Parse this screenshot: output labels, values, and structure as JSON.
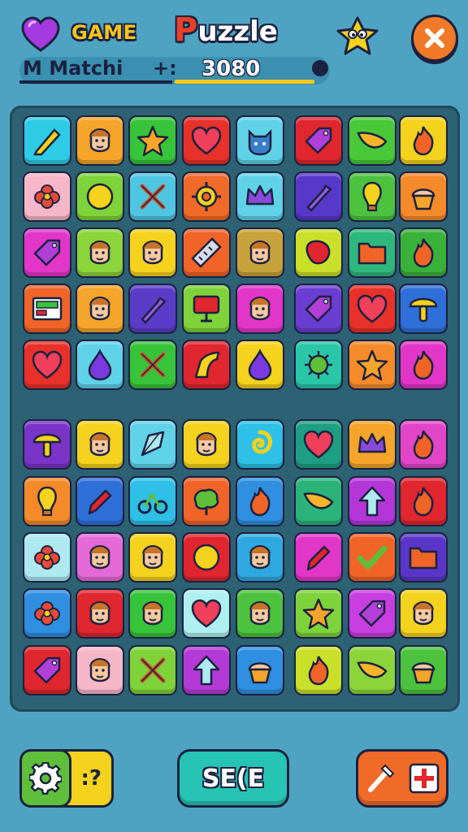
{
  "header": {
    "game_label": "GAME",
    "title_first": "P",
    "title_rest": "uzzle",
    "match_label": "M Matchi",
    "plus_label": "+:",
    "score": "3080",
    "score_progress": 0.88
  },
  "footer": {
    "left_label": ":?",
    "center_label": "SE(E"
  },
  "colors": {
    "background": "#4fa3c2",
    "board": "#2d6174",
    "accent_orange": "#f07a28",
    "accent_yellow": "#f4d21d",
    "accent_teal": "#27c4b4",
    "settings_green": "#5fbf3a"
  },
  "board": {
    "rows": [
      [
        [
          "#2ecbe6",
          "pencil"
        ],
        [
          "#f5a52a",
          "face"
        ],
        [
          "#38c43a",
          "star"
        ],
        [
          "#e8312a",
          "heart"
        ],
        [
          "#5fd2e8",
          "cat"
        ],
        [
          "#e0262e",
          "tag"
        ],
        [
          "#49c83a",
          "leaf"
        ],
        [
          "#f4d21d",
          "flame"
        ]
      ],
      [
        [
          "#f7b7c8",
          "flower"
        ],
        [
          "#7ed23a",
          "circle"
        ],
        [
          "#4ec6e2",
          "x-mark"
        ],
        [
          "#f06a28",
          "gear"
        ],
        [
          "#5fd2e8",
          "crown"
        ],
        [
          "#5738c8",
          "bottle"
        ],
        [
          "#4cc23e",
          "bulb"
        ],
        [
          "#f58a2a",
          "cupcake"
        ]
      ],
      [
        [
          "#e236c8",
          "tag"
        ],
        [
          "#8bd43a",
          "face"
        ],
        [
          "#f4d21d",
          "face"
        ],
        [
          "#f06428",
          "ruler"
        ],
        [
          "#c8a23a",
          "face"
        ],
        [
          "#c8e02a",
          "blob"
        ],
        [
          "#2fb87e",
          "folder"
        ],
        [
          "#3ab23a",
          "flame"
        ]
      ],
      [
        [
          "#f06428",
          "screen"
        ],
        [
          "#f5a52a",
          "face"
        ],
        [
          "#5a3cc8",
          "bottle"
        ],
        [
          "#7ed23a",
          "monitor"
        ],
        [
          "#e236c8",
          "face"
        ],
        [
          "#6a3ed0",
          "tag"
        ],
        [
          "#e8312a",
          "heart"
        ],
        [
          "#2f6fd8",
          "mushroom"
        ]
      ],
      [
        [
          "#e8312a",
          "heart"
        ],
        [
          "#5fd2e8",
          "drop"
        ],
        [
          "#38c43a",
          "x-mark"
        ],
        [
          "#e0262e",
          "wedge"
        ],
        [
          "#f4d21d",
          "drop"
        ],
        [
          "#2ac6a8",
          "germ"
        ],
        [
          "#f58a2a",
          "star"
        ],
        [
          "#e236c8",
          "flame"
        ]
      ],
      [
        [
          "#7a34c8",
          "mushroom"
        ],
        [
          "#f4d21d",
          "face"
        ],
        [
          "#5fd2e8",
          "kite"
        ],
        [
          "#f4d21d",
          "face"
        ],
        [
          "#2ec0e6",
          "swirl"
        ],
        [
          "#1e9e82",
          "heart"
        ],
        [
          "#f5a52a",
          "crown"
        ],
        [
          "#e246c8",
          "flame"
        ]
      ],
      [
        [
          "#f58a2a",
          "bulb"
        ],
        [
          "#2f6fd8",
          "pen"
        ],
        [
          "#2ec0e6",
          "bike"
        ],
        [
          "#f06428",
          "tree"
        ],
        [
          "#2f8fe0",
          "flame"
        ],
        [
          "#2ab47a",
          "leaf"
        ],
        [
          "#b436d8",
          "arrow"
        ],
        [
          "#e0262e",
          "flame"
        ]
      ],
      [
        [
          "#aee8f0",
          "flower"
        ],
        [
          "#e46ad8",
          "face"
        ],
        [
          "#f4d21d",
          "face"
        ],
        [
          "#e0262e",
          "circle"
        ],
        [
          "#2fa8e0",
          "face"
        ],
        [
          "#e236c8",
          "pen"
        ],
        [
          "#f06428",
          "check"
        ],
        [
          "#5a36c8",
          "folder"
        ]
      ],
      [
        [
          "#2f8fe0",
          "flower"
        ],
        [
          "#e0262e",
          "face"
        ],
        [
          "#38c43a",
          "face"
        ],
        [
          "#aef0f0",
          "heart"
        ],
        [
          "#4cc23e",
          "face"
        ],
        [
          "#7ed23a",
          "star"
        ],
        [
          "#c83ee0",
          "tag"
        ],
        [
          "#f4d21d",
          "face"
        ]
      ],
      [
        [
          "#e0262e",
          "tag"
        ],
        [
          "#f7b7c8",
          "face"
        ],
        [
          "#7ed23a",
          "x-mark"
        ],
        [
          "#b43ad8",
          "arrow"
        ],
        [
          "#2f8fe0",
          "cupcake"
        ],
        [
          "#c8e02a",
          "flame"
        ],
        [
          "#8bd43a",
          "leaf"
        ],
        [
          "#4cc23e",
          "cupcake"
        ]
      ]
    ]
  }
}
